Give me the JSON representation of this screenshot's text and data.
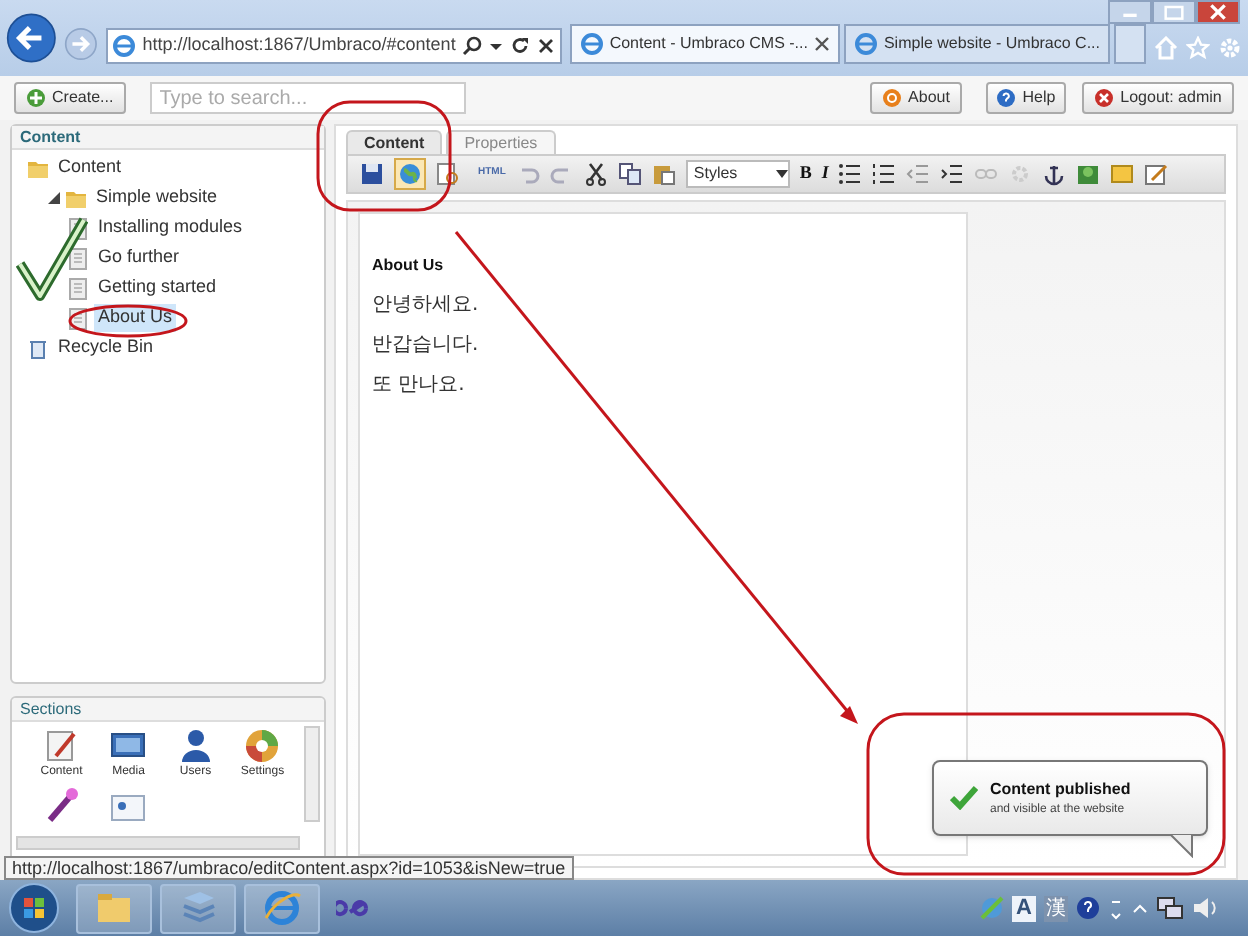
{
  "browser": {
    "address": "http://localhost:1867/Umbraco/#content",
    "tabs": [
      {
        "title": "Content - Umbraco CMS -...",
        "selected": true
      },
      {
        "title": "Simple website - Umbraco C...",
        "selected": false
      }
    ]
  },
  "app_toolbar": {
    "create": "Create...",
    "search_placeholder": "Type to search...",
    "buttons": [
      {
        "kind": "about",
        "label": "About"
      },
      {
        "kind": "help",
        "label": "Help"
      },
      {
        "kind": "logout",
        "label": "Logout: admin"
      }
    ]
  },
  "tree": {
    "title": "Content",
    "items": [
      {
        "label": "Content",
        "kind": "folder",
        "selected": false,
        "children": [
          {
            "label": "Simple website",
            "kind": "folder",
            "selected": false,
            "expanded": true,
            "children": [
              {
                "label": "Installing modules",
                "kind": "page",
                "selected": false
              },
              {
                "label": "Go further",
                "kind": "page",
                "selected": false
              },
              {
                "label": "Getting started",
                "kind": "page",
                "selected": false
              },
              {
                "label": "About Us",
                "kind": "page",
                "selected": true
              }
            ]
          }
        ]
      },
      {
        "label": "Recycle Bin",
        "kind": "bin",
        "selected": false
      }
    ]
  },
  "sections": {
    "title": "Sections",
    "items": [
      {
        "kind": "content",
        "label": "Content"
      },
      {
        "kind": "media",
        "label": "Media"
      },
      {
        "kind": "users",
        "label": "Users"
      },
      {
        "kind": "settings",
        "label": "Settings"
      },
      {
        "kind": "developer"
      },
      {
        "kind": "members"
      }
    ]
  },
  "editor": {
    "tabs": [
      {
        "label": "Content",
        "selected": true
      },
      {
        "label": "Properties",
        "selected": false
      }
    ],
    "toolbar": {
      "publish_hovered": true,
      "html": "HTML",
      "styles": "Styles",
      "bold": "B",
      "italic": "I"
    },
    "heading": "About Us",
    "paragraphs": [
      "안녕하세요.",
      "반갑습니다.",
      "또 만나요."
    ]
  },
  "toast": {
    "title": "Content published",
    "message": "and visible at the website"
  },
  "status_tooltip": "http://localhost:1867/umbraco/editContent.aspx?id=1053&isNew=true",
  "tray": {
    "ime_mode": "A",
    "ime_hanja": "漢"
  }
}
